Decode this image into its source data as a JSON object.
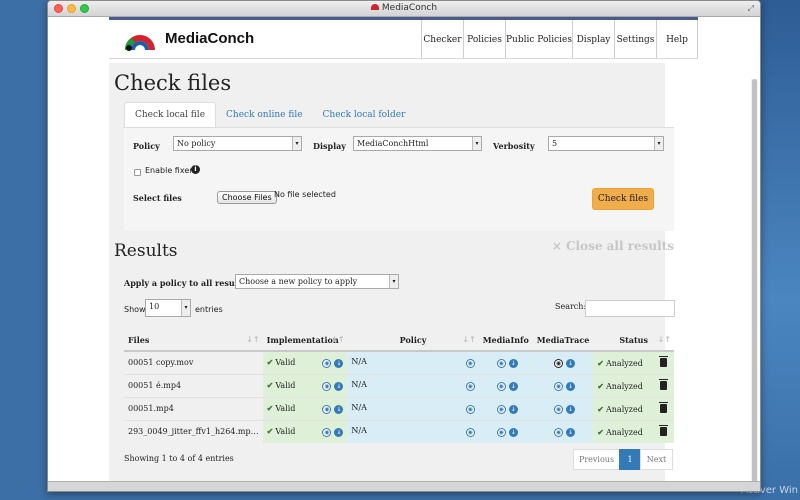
{
  "window": {
    "title": "MediaConch",
    "activer": "Activer Win"
  },
  "navbar": {
    "brand": "MediaConch",
    "links": [
      "Checker",
      "Policies",
      "Public Policies",
      "Display",
      "Settings",
      "Help"
    ]
  },
  "page": {
    "title": "Check files"
  },
  "tabs": [
    "Check local file",
    "Check online file",
    "Check local folder"
  ],
  "form": {
    "policy_label": "Policy",
    "policy_value": "No policy",
    "display_label": "Display",
    "display_value": "MediaConchHtml",
    "verbosity_label": "Verbosity",
    "verbosity_value": "5",
    "enable_fixer": "Enable fixer",
    "select_files": "Select files",
    "choose_files": "Choose Files",
    "no_file": "No file selected",
    "check_button": "Check files"
  },
  "results": {
    "title": "Results",
    "close_all": "× Close all results",
    "apply_label": "Apply a policy to all results",
    "apply_placeholder": "Choose a new policy to apply",
    "show_label": "Show",
    "show_value": "10",
    "entries_label": "entries",
    "search_label": "Search:",
    "columns": [
      "Files",
      "Implementation",
      "Policy",
      "MediaInfo",
      "MediaTrace",
      "Status"
    ],
    "rows": [
      {
        "file": "00051 copy.mov",
        "implementation": "Valid",
        "policy": "N/A",
        "status": "Analyzed"
      },
      {
        "file": "00051 é.mp4",
        "implementation": "Valid",
        "policy": "N/A",
        "status": "Analyzed"
      },
      {
        "file": "00051.mp4",
        "implementation": "Valid",
        "policy": "N/A",
        "status": "Analyzed"
      },
      {
        "file": "293_0049_jitter_ffv1_h264.mp…",
        "implementation": "Valid",
        "policy": "N/A",
        "status": "Analyzed"
      }
    ],
    "showing": "Showing 1 to 4 of 4 entries",
    "pagination": {
      "previous": "Previous",
      "current": "1",
      "next": "Next"
    }
  },
  "colors": {
    "accent_button": "#f0ad4e",
    "link": "#337ab7",
    "valid_bg": "#dff0d8",
    "policy_bg": "#d9edf7"
  }
}
